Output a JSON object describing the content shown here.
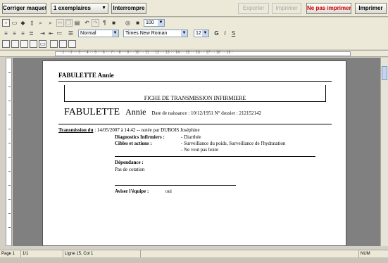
{
  "topbar": {
    "btn_corriger": "Corriger maquette",
    "copies": "1 exemplaires",
    "btn_interrompre": "Interrompre",
    "btn_exporter": "Exporter",
    "btn_imprimer_apercu": "Imprimer",
    "btn_ne_pas_imprimer": "Ne pas imprimer",
    "btn_imprimer": "Imprimer"
  },
  "format_bar": {
    "zoom": "100",
    "style": "Normal",
    "font": "Times New Roman",
    "size": "12",
    "bold": "G",
    "italic": "I",
    "underline": "S"
  },
  "document": {
    "header_name": "FABULETTE Annie",
    "fiche_title": "FICHE DE TRANSMISSION INFIRMIERE",
    "last_name": "FABULETTE",
    "first_name": "Annie",
    "dob_line": "Date de naissance : 10/12/1951  N° dossier : 212152142",
    "transmission_label": "Transmission du",
    "transmission_text": " : 14/05/2007 à 14:42 -- notée par DUBOIS Joséphine",
    "diag_label": "Diagnostics Infirmiers :",
    "diag_value": "- Diarrhée",
    "cibles_label": "Cibles et actions :",
    "cibles_value_1": "- Surveillance du poids, Surveillance de l'hydratation",
    "cibles_value_2": "- Ne veut pas boire",
    "dependance_label": "Dépendance :",
    "dependance_value": "Pas de cotation",
    "aviser_label": "Aviser l'équipe :",
    "aviser_value": "oui"
  },
  "statusbar": {
    "page": "Page 1",
    "pages": "1/1",
    "position": "Ligne 15, Col 1",
    "mode": "NUM"
  },
  "colors": {
    "accent_red": "#d00000",
    "workspace": "#808080"
  }
}
